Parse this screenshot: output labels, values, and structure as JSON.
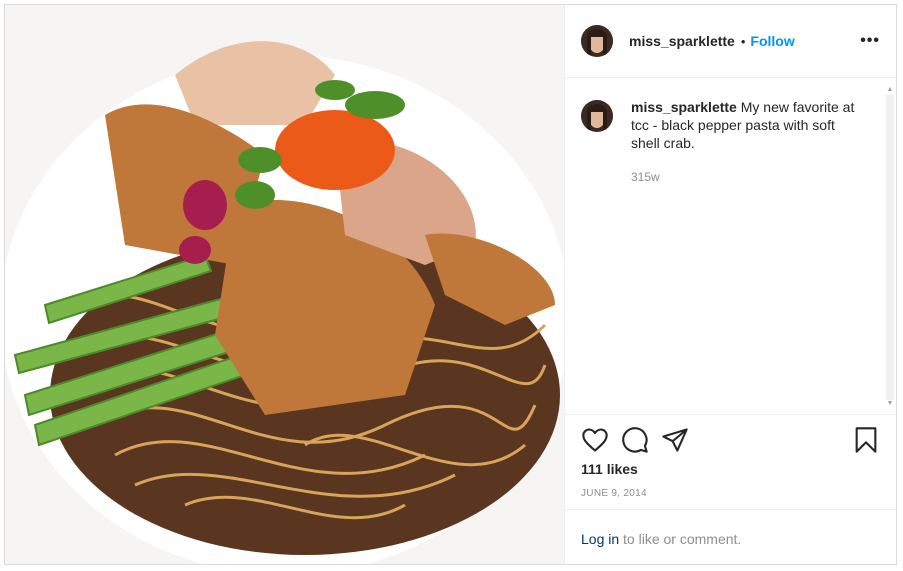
{
  "post": {
    "image_alt": "Black pepper pasta with soft shell crab, asparagus, microgreens and tobiko on a white plate",
    "author": {
      "username": "miss_sparklette",
      "separator": "•",
      "follow_label": "Follow",
      "more_label": "•••"
    },
    "caption": {
      "username": "miss_sparklette",
      "text": " My new favorite at tcc - black pepper pasta with soft shell crab.",
      "age": "315w"
    },
    "actions": {
      "like_icon": "heart-icon",
      "comment_icon": "comment-icon",
      "share_icon": "share-icon",
      "save_icon": "bookmark-icon"
    },
    "likes": "111 likes",
    "date": "JUNE 9, 2014",
    "login_prompt": {
      "link": "Log in",
      "text": " to like or comment."
    }
  },
  "colors": {
    "follow": "#0095f6",
    "muted": "#8e8e8e",
    "text": "#262626",
    "login_link": "#00376b"
  }
}
